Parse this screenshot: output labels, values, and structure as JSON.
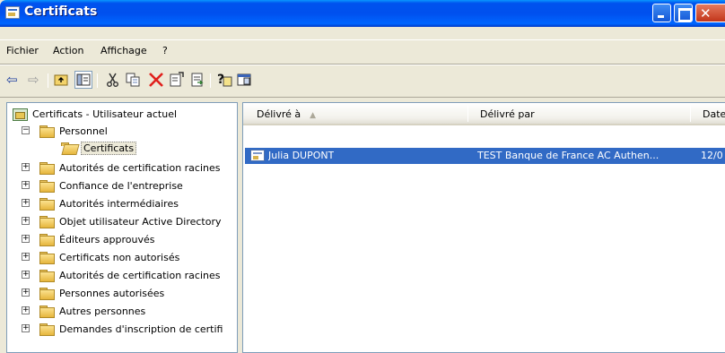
{
  "window": {
    "title": "Certificats"
  },
  "menu": [
    "Fichier",
    "Action",
    "Affichage",
    "?"
  ],
  "toolbar": {
    "icons": [
      "back-arrow-icon",
      "forward-arrow-icon",
      "up-folder-icon",
      "show-tree-icon",
      "cut-icon",
      "copy-icon",
      "delete-icon",
      "properties-icon",
      "export-icon",
      "help-icon",
      "description-icon"
    ]
  },
  "tree": {
    "root": "Certificats - Utilisateur actuel",
    "personnel": "Personnel",
    "certificats": "Certificats",
    "items": [
      "Autorités de certification racines",
      "Confiance de l'entreprise",
      "Autorités intermédiaires",
      "Objet utilisateur Active Directory",
      "Éditeurs approuvés",
      "Certificats non autorisés",
      "Autorités de certification racines",
      "Personnes autorisées",
      "Autres personnes",
      "Demandes d'inscription de certifi"
    ]
  },
  "list": {
    "columns": [
      "Délivré à",
      "Délivré par",
      "Date"
    ],
    "rows": [
      {
        "issued_to": "Julia DUPONT",
        "issued_by": "TEST Banque de France AC Authen...",
        "date": "12/0"
      }
    ]
  },
  "colors": {
    "selection": "#316ac5",
    "titlebar": "#0054e3",
    "face": "#ece9d8"
  }
}
